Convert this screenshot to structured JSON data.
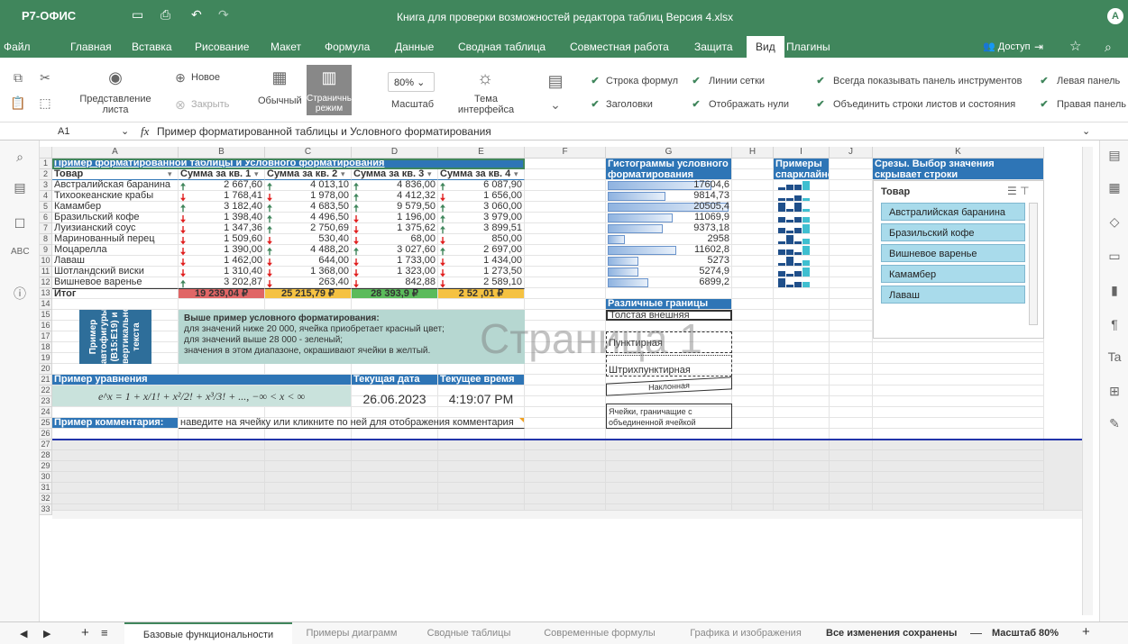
{
  "app": {
    "logo": "Р7-ОФИС",
    "title": "Книга для проверки возможностей редактора таблиц Версия 4.xlsx",
    "user_initial": "A"
  },
  "menu": [
    "Файл",
    "Главная",
    "Вставка",
    "Рисование",
    "Макет",
    "Формула",
    "Данные",
    "Сводная таблица",
    "Совместная работа",
    "Защита",
    "Вид",
    "Плагины"
  ],
  "menu_active": "Вид",
  "access": "Доступ",
  "ribbon": {
    "new": "Новое",
    "close": "Закрыть",
    "view_sheet": "Представление листа",
    "normal": "Обычный",
    "page_mode": "Страничный режим",
    "zoom": "80%",
    "zoom_label": "Масштаб",
    "theme": "Тема интерфейса",
    "checks": [
      "Строка формул",
      "Линии сетки",
      "Заголовки",
      "Отображать нули",
      "Всегда показывать панель инструментов",
      "Левая панель",
      "Объединить строки листов и состояния",
      "Правая панель"
    ]
  },
  "formula": {
    "cell": "A1",
    "fx": "fx",
    "value": "Пример форматированной таблицы и Условного форматирования"
  },
  "cols": [
    "A",
    "B",
    "C",
    "D",
    "E",
    "F",
    "G",
    "H",
    "I",
    "J",
    "K"
  ],
  "rows": [
    "1",
    "2",
    "3",
    "4",
    "5",
    "6",
    "7",
    "8",
    "9",
    "10",
    "11",
    "12",
    "13",
    "14",
    "15",
    "16",
    "17",
    "18",
    "19",
    "20",
    "21",
    "22",
    "23",
    "24",
    "25",
    "26",
    "27",
    "28",
    "29",
    "30",
    "31",
    "32",
    "33"
  ],
  "table": {
    "title": "Пример форматированной таблицы и Условного форматирования",
    "headers": [
      "Товар",
      "Сумма за кв. 1",
      "Сумма за кв. 2",
      "Сумма за кв. 3",
      "Сумма за кв. 4"
    ],
    "rows": [
      [
        "Австралийская баранина",
        "2 667,60",
        "4 013,10",
        "4 836,00",
        "6 087,90"
      ],
      [
        "Тихоокеанские крабы",
        "1 768,41",
        "1 978,00",
        "4 412,32",
        "1 656,00"
      ],
      [
        "Камамбер",
        "3 182,40",
        "4 683,50",
        "9 579,50",
        "3 060,00"
      ],
      [
        "Бразильский кофе",
        "1 398,40",
        "4 496,50",
        "1 196,00",
        "3 979,00"
      ],
      [
        "Луизианский соус",
        "1 347,36",
        "2 750,69",
        "1 375,62",
        "3 899,51"
      ],
      [
        "Маринованный перец",
        "1 509,60",
        "530,40",
        "68,00",
        "850,00"
      ],
      [
        "Моцарелла",
        "1 390,00",
        "4 488,20",
        "3 027,60",
        "2 697,00"
      ],
      [
        "Лаваш",
        "1 462,00",
        "644,00",
        "1 733,00",
        "1 434,00"
      ],
      [
        "Шотландский виски",
        "1 310,40",
        "1 368,00",
        "1 323,00",
        "1 273,50"
      ],
      [
        "Вишневое варенье",
        "3 202,87",
        "263,40",
        "842,88",
        "2 589,10"
      ]
    ],
    "arrows": [
      [
        "up",
        "up",
        "up",
        "up"
      ],
      [
        "down",
        "down",
        "up",
        "down"
      ],
      [
        "up",
        "up",
        "up",
        "up"
      ],
      [
        "down",
        "up",
        "down",
        "up"
      ],
      [
        "down",
        "up",
        "down",
        "up"
      ],
      [
        "down",
        "down",
        "down",
        "down"
      ],
      [
        "down",
        "up",
        "up",
        "up"
      ],
      [
        "down",
        "down",
        "down",
        "down"
      ],
      [
        "down",
        "down",
        "down",
        "down"
      ],
      [
        "up",
        "down",
        "down",
        "down"
      ]
    ],
    "total_label": "Итог",
    "totals": [
      "19 239,04 ₽",
      "25 215,79 ₽",
      "28 393,9  ₽",
      "2  52 ,01  ₽"
    ]
  },
  "shape_text": "Пример автофигуры (B15:E19) и вертикального текста",
  "cf_note": {
    "title": "Выше пример условного форматирования:",
    "lines": [
      "для значений ниже 20 000, ячейка приобретает красный цвет;",
      "для значений выше 28 000 - зеленый;",
      "значения в этом диапазоне, окрашивают ячейки в желтый."
    ]
  },
  "equation_label": "Пример уравнения",
  "date_label": "Текущая дата",
  "time_label": "Текущее время",
  "date": "26.06.2023",
  "time": "4:19:07 PM",
  "equation": "e^x = 1 + x/1! + x²/2! + x³/3! + ..., −∞ < x < ∞",
  "comment_label": "Пример комментария:",
  "comment_text": "наведите на ячейку или кликните по ней для отображения комментария",
  "hist": {
    "title": "Гистограммы условного форматирования",
    "values": [
      "17604,6",
      "9814,73",
      "20505,4",
      "11069,9",
      "9373,18",
      "2958",
      "11602,8",
      "5273",
      "5274,9",
      "6899,2"
    ],
    "num": [
      17604.6,
      9814.73,
      20505.4,
      11069.9,
      9373.18,
      2958,
      11602.8,
      5273,
      5274.9,
      6899.2
    ]
  },
  "sparks_title": "Примеры спарклайнов",
  "borders": {
    "title": "Различные границы",
    "thick": "Толстая внешняя",
    "dashed": "Пунктирная",
    "dashdot": "Штрихпунктирная",
    "slanted": "Наклонная",
    "merged": "Ячейки, граничащие с объединенной ячейкой"
  },
  "slicer": {
    "title": "Срезы. Выбор значения скрывает строки Форматированной таблицы",
    "header": "Товар",
    "items": [
      "Австралийская баранина",
      "Бразильский кофе",
      "Вишневое варенье",
      "Камамбер",
      "Лаваш"
    ]
  },
  "watermark": "Страница 1",
  "tabs": [
    "Базовые функциональности",
    "Примеры диаграмм",
    "Сводные таблицы",
    "Современные формулы",
    "Графика и изображения"
  ],
  "status": {
    "saved": "Все изменения сохранены",
    "zoom": "Масштаб 80%"
  },
  "colors": {
    "brand": "#40865c",
    "tbl_header": "#2e75b6",
    "green_cell": "#5bbb5b",
    "red_cell": "#e06666",
    "yellow_cell": "#f5c242",
    "shape": "#2e6e9a",
    "note_bg": "#b6d7d1"
  }
}
